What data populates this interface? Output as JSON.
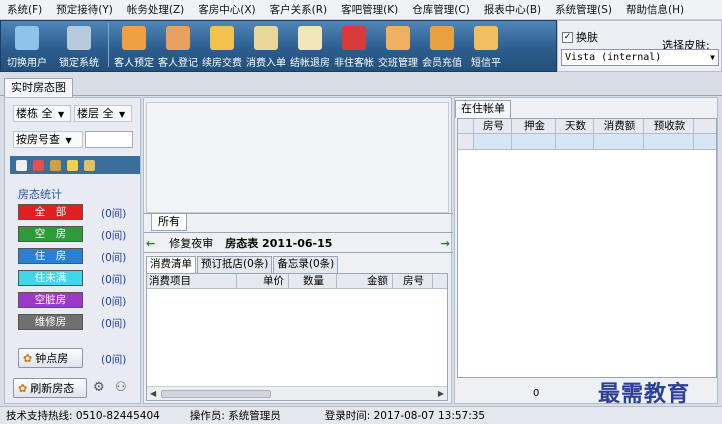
{
  "menu": [
    "系统(F)",
    "预定接待(Y)",
    "帐务处理(Z)",
    "客房中心(X)",
    "客户关系(R)",
    "客吧管理(K)",
    "仓库管理(C)",
    "报表中心(B)",
    "系统管理(S)",
    "帮助信息(H)"
  ],
  "toolbar": [
    {
      "label": "切换用户",
      "icon": "switch-user-icon",
      "color": "#8ec3ea"
    },
    {
      "label": "锁定系统",
      "icon": "lock-screen-icon",
      "color": "#b7c9dc"
    },
    {
      "label": "客人预定",
      "icon": "clock-icon",
      "color": "#f0a040"
    },
    {
      "label": "客人登记",
      "icon": "add-person-icon",
      "color": "#e8a060"
    },
    {
      "label": "续房交费",
      "icon": "coins-icon",
      "color": "#f3c24a"
    },
    {
      "label": "消费入单",
      "icon": "clipboard-icon",
      "color": "#e9d79a"
    },
    {
      "label": "结帐退房",
      "icon": "checkout-icon",
      "color": "#f2e6b8"
    },
    {
      "label": "非住客帐",
      "icon": "can-icon",
      "color": "#d93a3a"
    },
    {
      "label": "交班管理",
      "icon": "handover-icon",
      "color": "#f0b060"
    },
    {
      "label": "会员充值",
      "icon": "card-icon",
      "color": "#e8a040"
    },
    {
      "label": "短信平",
      "icon": "sms-icon",
      "color": "#f0c060"
    }
  ],
  "skin": {
    "checkbox_label": "换肤",
    "checked": true,
    "select_label": "选择皮肤:",
    "select_value": "Vista (internal)"
  },
  "main_tab": "实时房态图",
  "filters": {
    "building_label": "楼栋",
    "building_value": "全",
    "floor_label": "楼层",
    "floor_value": "全",
    "search_mode": "按房号查"
  },
  "stats": {
    "title": "房态统计",
    "items": [
      {
        "label": "全　部",
        "count": "(0间)",
        "color": "#e02020"
      },
      {
        "label": "空　房",
        "count": "(0间)",
        "color": "#2e9a3a"
      },
      {
        "label": "住　房",
        "count": "(0间)",
        "color": "#2a7fd0"
      },
      {
        "label": "住未满",
        "count": "(0间)",
        "color": "#40d8e8"
      },
      {
        "label": "空脏房",
        "count": "(0间)",
        "color": "#9a38c8"
      },
      {
        "label": "维修房",
        "count": "(0间)",
        "color": "#707070"
      }
    ],
    "hourly_label": "钟点房",
    "hourly_count": "(0间)"
  },
  "refresh_label": "刷新房态",
  "room_area": {
    "all_tab": "所有",
    "nav_left": "←",
    "night_audit": "修复夜审",
    "date_label": "房态表 2011-06-15",
    "nav_right": "→",
    "subtabs": [
      "消费清单",
      "预订抵店(0条)",
      "备忘录(0条)"
    ],
    "columns": [
      "消费项目",
      "单价",
      "数量",
      "金额",
      "房号"
    ]
  },
  "accounts": {
    "tab": "在住帐单",
    "columns": [
      "房号",
      "押金",
      "天数",
      "消费额",
      "预收款"
    ],
    "footer_value": "0"
  },
  "status": {
    "support": "技术支持热线: 0510-82445404",
    "operator": "操作员: 系统管理员",
    "login": "登录时间: 2017-08-07 13:57:35"
  },
  "watermark": "最需教育"
}
